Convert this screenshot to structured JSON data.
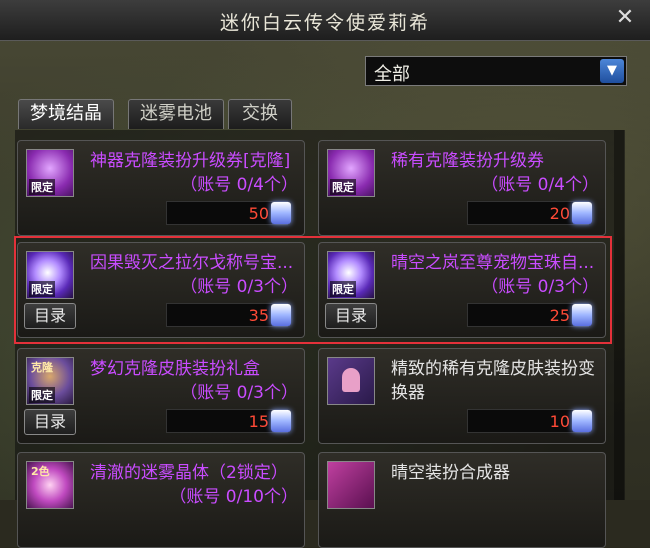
{
  "window": {
    "title": "迷你白云传令使爱莉希",
    "close_glyph": "✕"
  },
  "filter": {
    "selected": "全部",
    "arrow_glyph": "▼"
  },
  "tabs": [
    "梦境结晶",
    "迷雾电池",
    "交换"
  ],
  "directory_label": "目录",
  "items": [
    {
      "name": "神器克隆装扮升级券[克隆]",
      "limit": "（账号 0/4个）",
      "price": "50",
      "badge": "限定",
      "color": "purple",
      "has_dir": false
    },
    {
      "name": "稀有克隆装扮升级券",
      "limit": "（账号 0/4个）",
      "price": "20",
      "badge": "限定",
      "color": "purple",
      "has_dir": false
    },
    {
      "name": "因果毁灭之拉尔戈称号宝...",
      "limit": "（账号 0/3个）",
      "price": "35",
      "badge": "限定",
      "color": "purple",
      "has_dir": true
    },
    {
      "name": "晴空之岚至尊宠物宝珠自...",
      "limit": "（账号 0/3个）",
      "price": "25",
      "badge": "限定",
      "color": "purple",
      "has_dir": true
    },
    {
      "name": "梦幻克隆皮肤装扮礼盒",
      "limit": "（账号 0/3个）",
      "price": "15",
      "badge": "限定",
      "badge_top": "克隆",
      "color": "purple",
      "has_dir": true
    },
    {
      "name": "精致的稀有克隆皮肤装扮变换器",
      "limit": "",
      "price": "10",
      "badge": "",
      "color": "white",
      "has_dir": false
    },
    {
      "name": "清澈的迷雾晶体（2锁定）",
      "limit": "（账号 0/10个）",
      "price": "",
      "badge": "",
      "badge_top": "2色",
      "color": "purple",
      "has_dir": false
    },
    {
      "name": "晴空装扮合成器",
      "limit": "",
      "price": "",
      "badge": "",
      "color": "white",
      "has_dir": false
    }
  ]
}
